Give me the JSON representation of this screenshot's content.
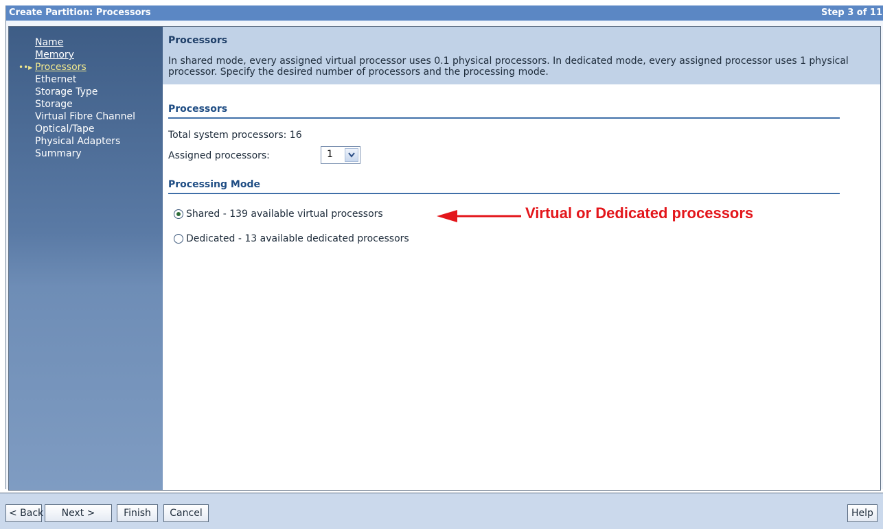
{
  "window": {
    "title": "Create Partition: Processors",
    "step": "Step 3 of 11"
  },
  "sidebar": {
    "items": [
      {
        "label": "Name",
        "state": "link"
      },
      {
        "label": "Memory",
        "state": "link"
      },
      {
        "label": "Processors",
        "state": "current"
      },
      {
        "label": "Ethernet",
        "state": "plain"
      },
      {
        "label": "Storage Type",
        "state": "plain"
      },
      {
        "label": "Storage",
        "state": "plain"
      },
      {
        "label": "Virtual Fibre Channel",
        "state": "plain"
      },
      {
        "label": "Optical/Tape",
        "state": "plain"
      },
      {
        "label": "Physical Adapters",
        "state": "plain"
      },
      {
        "label": "Summary",
        "state": "plain"
      }
    ],
    "current_marker_icon": "arrow-right-icon"
  },
  "header": {
    "title": "Processors",
    "description": "In shared mode, every assigned virtual processor uses 0.1 physical processors. In dedicated mode, every assigned processor uses 1 physical processor. Specify the desired number of processors and the processing mode."
  },
  "processors_section": {
    "title": "Processors",
    "total_label": "Total system processors: 16",
    "assigned_label": "Assigned processors:",
    "assigned_value": "1"
  },
  "mode_section": {
    "title": "Processing Mode",
    "options": [
      {
        "label": "Shared - 139 available virtual processors",
        "checked": true
      },
      {
        "label": "Dedicated - 13 available dedicated processors",
        "checked": false
      }
    ]
  },
  "annotation": {
    "text": "Virtual or Dedicated processors",
    "color": "#e3161b"
  },
  "footer": {
    "back": "< Back",
    "next": "Next >",
    "finish": "Finish",
    "cancel": "Cancel",
    "help": "Help"
  }
}
